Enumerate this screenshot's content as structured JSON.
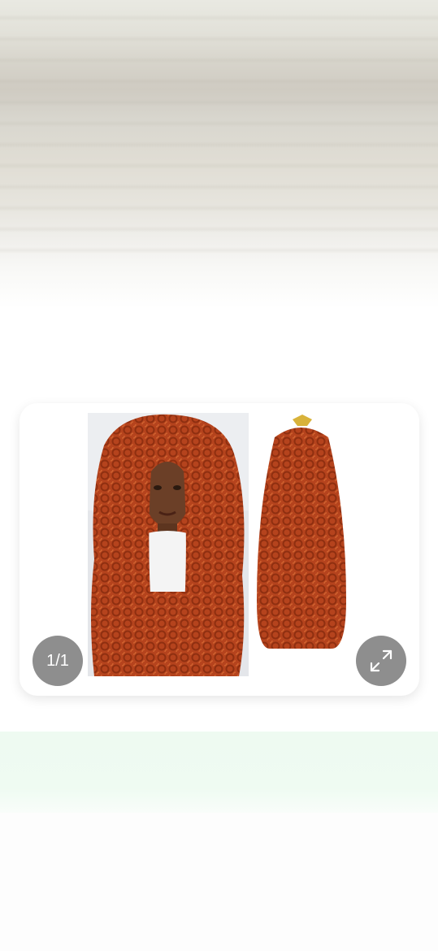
{
  "gallery": {
    "counter": "1/1",
    "image": {
      "alt_icon": "product-photo-curly-hair-extension",
      "hair_color": "#b5431d",
      "hair_color_dark": "#8f2f10",
      "skin_color": "#6b3f27"
    },
    "expand_icon": "expand-arrows-icon"
  },
  "colors": {
    "badge_bg": "#8e8e8e",
    "mint_band": "#eefaf1"
  }
}
